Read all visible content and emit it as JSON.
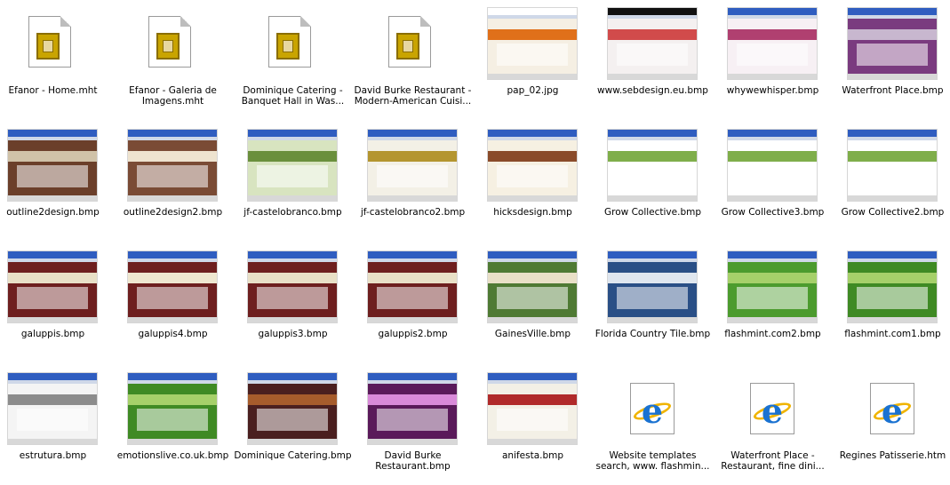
{
  "files": [
    {
      "name": "Efanor - Home.mht",
      "kind": "mht",
      "icon": "mht-file-icon"
    },
    {
      "name": "Efanor - Galeria de Imagens.mht",
      "kind": "mht",
      "icon": "mht-file-icon"
    },
    {
      "name": "Dominique Catering - Banquet Hall in Was...",
      "kind": "mht",
      "icon": "mht-file-icon"
    },
    {
      "name": "David Burke Restaurant - Modern-American Cuisi...",
      "kind": "mht",
      "icon": "mht-file-icon"
    },
    {
      "name": "pap_02.jpg",
      "kind": "img",
      "icon": "image-thumbnail",
      "theme": {
        "top": "#ffffff",
        "mid": "#f5efe3",
        "accent": "#e0701a"
      }
    },
    {
      "name": "www.sebdesign.eu.bmp",
      "kind": "img",
      "icon": "image-thumbnail",
      "theme": {
        "top": "#111111",
        "mid": "#f4f0f0",
        "accent": "#d14b4b"
      }
    },
    {
      "name": "whywewhisper.bmp",
      "kind": "img",
      "icon": "image-thumbnail",
      "theme": {
        "top": "#2f5dc0",
        "mid": "#f7f0f4",
        "accent": "#b04070"
      }
    },
    {
      "name": "Waterfront Place.bmp",
      "kind": "img",
      "icon": "image-thumbnail",
      "theme": {
        "top": "#2f5dc0",
        "mid": "#7a3b7f",
        "accent": "#c8b7cf"
      }
    },
    {
      "name": "outline2design.bmp",
      "kind": "img",
      "icon": "image-thumbnail",
      "theme": {
        "top": "#2f5dc0",
        "mid": "#6b3f2a",
        "accent": "#d0c2a8"
      }
    },
    {
      "name": "outline2design2.bmp",
      "kind": "img",
      "icon": "image-thumbnail",
      "theme": {
        "top": "#2f5dc0",
        "mid": "#7a4b35",
        "accent": "#eee3cf"
      }
    },
    {
      "name": "jf-castelobranco.bmp",
      "kind": "img",
      "icon": "image-thumbnail",
      "theme": {
        "top": "#2f5dc0",
        "mid": "#d8e4c0",
        "accent": "#6a8f3c"
      }
    },
    {
      "name": "jf-castelobranco2.bmp",
      "kind": "img",
      "icon": "image-thumbnail",
      "theme": {
        "top": "#2f5dc0",
        "mid": "#f3f0e6",
        "accent": "#b4952f"
      }
    },
    {
      "name": "hicksdesign.bmp",
      "kind": "img",
      "icon": "image-thumbnail",
      "theme": {
        "top": "#2f5dc0",
        "mid": "#f6f0e2",
        "accent": "#8a4b2a"
      }
    },
    {
      "name": "Grow Collective.bmp",
      "kind": "img",
      "icon": "image-thumbnail",
      "theme": {
        "top": "#2f5dc0",
        "mid": "#ffffff",
        "accent": "#7fae4a"
      }
    },
    {
      "name": "Grow Collective3.bmp",
      "kind": "img",
      "icon": "image-thumbnail",
      "theme": {
        "top": "#2f5dc0",
        "mid": "#ffffff",
        "accent": "#7fae4a"
      }
    },
    {
      "name": "Grow Collective2.bmp",
      "kind": "img",
      "icon": "image-thumbnail",
      "theme": {
        "top": "#2f5dc0",
        "mid": "#ffffff",
        "accent": "#7fae4a"
      }
    },
    {
      "name": "galuppis.bmp",
      "kind": "img",
      "icon": "image-thumbnail",
      "theme": {
        "top": "#2f5dc0",
        "mid": "#6e1f1f",
        "accent": "#e9e0c7"
      }
    },
    {
      "name": "galuppis4.bmp",
      "kind": "img",
      "icon": "image-thumbnail",
      "theme": {
        "top": "#2f5dc0",
        "mid": "#6e1f1f",
        "accent": "#efe7d0"
      }
    },
    {
      "name": "galuppis3.bmp",
      "kind": "img",
      "icon": "image-thumbnail",
      "theme": {
        "top": "#2f5dc0",
        "mid": "#6e1f1f",
        "accent": "#e9e0c7"
      }
    },
    {
      "name": "galuppis2.bmp",
      "kind": "img",
      "icon": "image-thumbnail",
      "theme": {
        "top": "#2f5dc0",
        "mid": "#6e1f1f",
        "accent": "#e9e0c7"
      }
    },
    {
      "name": "GainesVille.bmp",
      "kind": "img",
      "icon": "image-thumbnail",
      "theme": {
        "top": "#2f5dc0",
        "mid": "#4f7a34",
        "accent": "#e9e0c7"
      }
    },
    {
      "name": "Florida Country Tile.bmp",
      "kind": "img",
      "icon": "image-thumbnail",
      "theme": {
        "top": "#2f5dc0",
        "mid": "#2a4f86",
        "accent": "#dfe6ef"
      }
    },
    {
      "name": "flashmint.com2.bmp",
      "kind": "img",
      "icon": "image-thumbnail",
      "theme": {
        "top": "#2f5dc0",
        "mid": "#4c9b2e",
        "accent": "#a6d06a"
      }
    },
    {
      "name": "flashmint.com1.bmp",
      "kind": "img",
      "icon": "image-thumbnail",
      "theme": {
        "top": "#2f5dc0",
        "mid": "#3f8a24",
        "accent": "#a6d06a"
      }
    },
    {
      "name": "estrutura.bmp",
      "kind": "img",
      "icon": "image-thumbnail",
      "theme": {
        "top": "#2f5dc0",
        "mid": "#f4f4f4",
        "accent": "#8c8c8c"
      }
    },
    {
      "name": "emotionslive.co.uk.bmp",
      "kind": "img",
      "icon": "image-thumbnail",
      "theme": {
        "top": "#2f5dc0",
        "mid": "#3f8a24",
        "accent": "#a6d06a"
      }
    },
    {
      "name": "Dominique Catering.bmp",
      "kind": "img",
      "icon": "image-thumbnail",
      "theme": {
        "top": "#2f5dc0",
        "mid": "#4a1f1f",
        "accent": "#a65c2c"
      }
    },
    {
      "name": "David Burke Restaurant.bmp",
      "kind": "img",
      "icon": "image-thumbnail",
      "theme": {
        "top": "#2f5dc0",
        "mid": "#5a1a5a",
        "accent": "#d98ad9"
      }
    },
    {
      "name": "anifesta.bmp",
      "kind": "img",
      "icon": "image-thumbnail",
      "theme": {
        "top": "#2f5dc0",
        "mid": "#f3f0e6",
        "accent": "#b02a2a"
      }
    },
    {
      "name": "Website templates search, www. flashmin...",
      "kind": "ie",
      "icon": "internet-explorer-icon"
    },
    {
      "name": "Waterfront Place - Restaurant, fine dini...",
      "kind": "ie",
      "icon": "internet-explorer-icon"
    },
    {
      "name": "Regines Patisserie.htm",
      "kind": "ie",
      "icon": "internet-explorer-icon"
    }
  ]
}
